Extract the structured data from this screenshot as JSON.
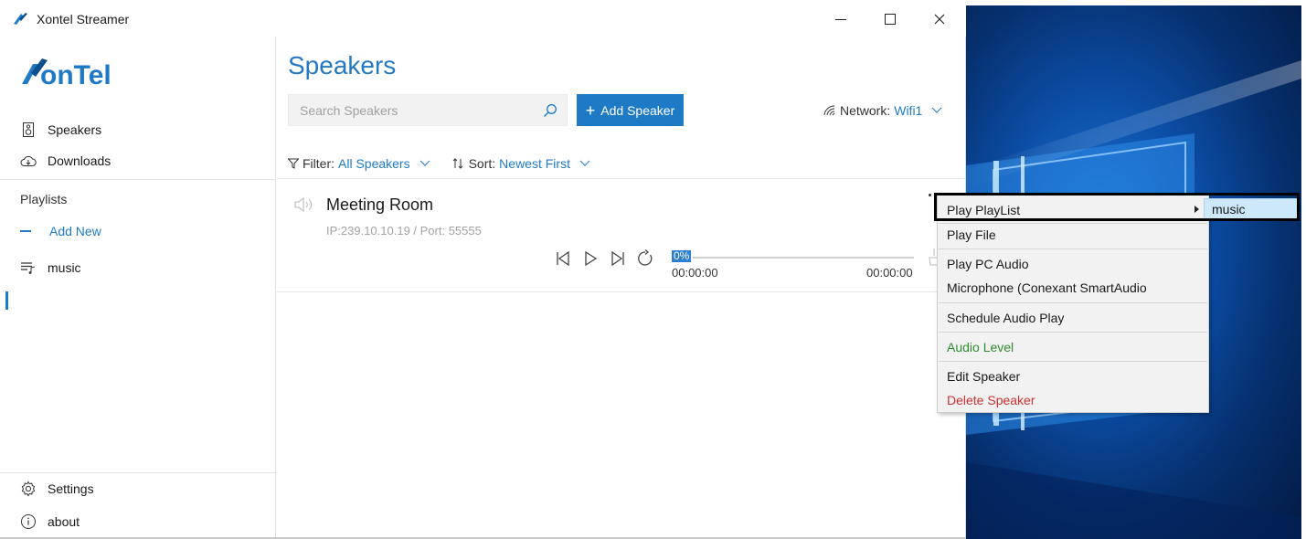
{
  "window": {
    "title": "Xontel Streamer",
    "controls": {
      "minimize": "minimize-icon",
      "maximize": "maximize-icon",
      "close": "close-icon"
    }
  },
  "brand": {
    "logo_text": "XonTel",
    "accent": "#1f7ac6"
  },
  "sidebar": {
    "nav": [
      {
        "label": "Speakers",
        "icon": "speaker-device-icon"
      },
      {
        "label": "Downloads",
        "icon": "cloud-download-icon"
      }
    ],
    "playlists_label": "Playlists",
    "add_new_label": "Add New",
    "playlists": [
      {
        "label": "music",
        "icon": "playlist-icon"
      }
    ],
    "bottom": [
      {
        "label": "Settings",
        "icon": "gear-icon"
      },
      {
        "label": "about",
        "icon": "info-icon"
      }
    ]
  },
  "main": {
    "title": "Speakers",
    "search": {
      "placeholder": "Search Speakers",
      "value": ""
    },
    "add_speaker_label": "Add Speaker",
    "network": {
      "label": "Network:",
      "value": "Wifi1"
    },
    "filter": {
      "label": "Filter:",
      "value": "All Speakers"
    },
    "sort": {
      "label": "Sort:",
      "value": "Newest First"
    },
    "speakers": [
      {
        "name": "Meeting Room",
        "address": "IP:239.10.10.19 / Port: 55555",
        "progress": {
          "percent_label": "0%",
          "percent": 0,
          "elapsed": "00:00:00",
          "duration": "00:00:00"
        }
      }
    ]
  },
  "context_menu": {
    "items": [
      {
        "label": "Play PlayList",
        "has_submenu": true
      },
      {
        "label": "Play File"
      },
      {
        "label": "Play PC Audio"
      },
      {
        "label": "Microphone (Conexant SmartAudio"
      },
      {
        "label": "Schedule Audio Play"
      },
      {
        "label": "Audio Level",
        "color": "#2e8b2e"
      },
      {
        "label": "Edit Speaker"
      },
      {
        "label": "Delete Speaker",
        "color": "#d03030"
      }
    ],
    "submenu": {
      "items": [
        {
          "label": "music"
        }
      ]
    }
  }
}
